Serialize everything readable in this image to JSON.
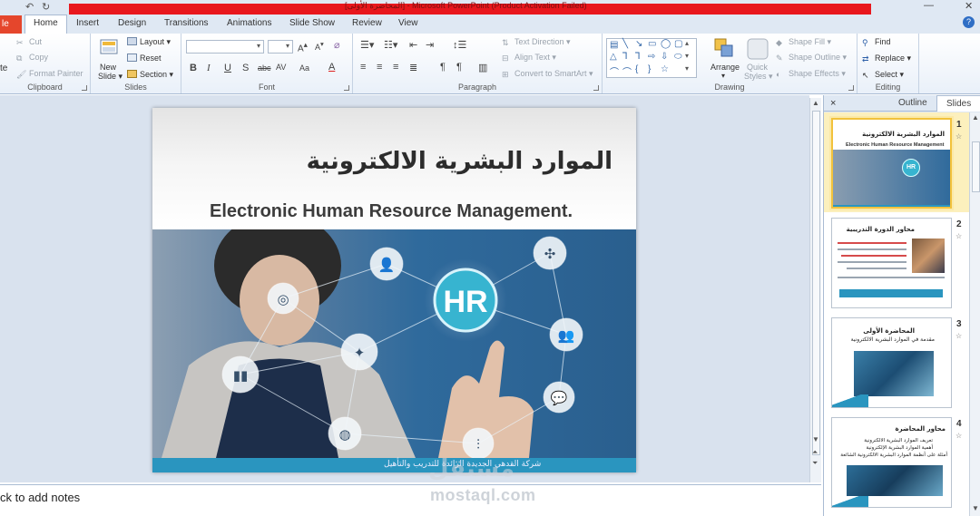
{
  "window": {
    "title": "[المحاضرة الأولى] - Microsoft PowerPoint (Product Activation Failed)"
  },
  "tabs": {
    "file": "le",
    "items": [
      "Home",
      "Insert",
      "Design",
      "Transitions",
      "Animations",
      "Slide Show",
      "Review",
      "View"
    ]
  },
  "ribbon": {
    "clipboard": {
      "paste": "te",
      "cut": "Cut",
      "copy": "Copy",
      "format_painter": "Format Painter",
      "label": "Clipboard"
    },
    "slides": {
      "new_slide_line1": "New",
      "new_slide_line2": "Slide",
      "layout": "Layout",
      "reset": "Reset",
      "section": "Section",
      "label": "Slides"
    },
    "font": {
      "label": "Font",
      "bold": "B",
      "italic": "I",
      "underline": "U",
      "shadow": "S",
      "strike": "abc",
      "spacing": "AV",
      "case": "Aa",
      "color": "A"
    },
    "paragraph": {
      "text_direction": "Text Direction",
      "align_text": "Align Text",
      "convert_smartart": "Convert to SmartArt",
      "label": "Paragraph"
    },
    "drawing": {
      "arrange": "Arrange",
      "quick_styles_line1": "Quick",
      "quick_styles_line2": "Styles",
      "shape_fill": "Shape Fill",
      "shape_outline": "Shape Outline",
      "shape_effects": "Shape Effects",
      "label": "Drawing"
    },
    "editing": {
      "find": "Find",
      "replace": "Replace",
      "select": "Select",
      "label": "Editing"
    }
  },
  "slide": {
    "arabic_title": "الموارد البشرية الالكترونية",
    "english_title": "Electronic Human Resource Management.",
    "hr_label": "HR",
    "footer": "شركة القدهي الجديدة الرائدة للتدريب والتأهيل"
  },
  "notes": {
    "placeholder": "ck to add notes"
  },
  "panel": {
    "tab_outline": "Outline",
    "tab_slides": "Slides",
    "close": "×",
    "thumbnails": [
      {
        "number": "1",
        "title": "الموارد البشرية الالكترونية",
        "subtitle": "Electronic Human Resource Management",
        "label": "HR"
      },
      {
        "number": "2",
        "title": "محاور الدورة التدريبية"
      },
      {
        "number": "3",
        "title": "المحاضرة الأولى",
        "subtitle": "مقدمة في الموارد البشرية الالكترونية"
      },
      {
        "number": "4",
        "title": "محاور المحاضرة",
        "items": [
          "تعريف الموارد البشرية الالكترونية",
          "أهمية الموارد البشرية الإلكترونية",
          "أمثلة على أنظمة الموارد البشرية الالكترونية الشائعة"
        ]
      }
    ]
  },
  "watermark": {
    "logo": "مستقل",
    "text": "mostaql.com"
  },
  "colors": {
    "accent": "#2a95bf",
    "file_tab": "#e5462c",
    "title_bar_red": "#e8171d",
    "selection": "#f2c23c"
  }
}
